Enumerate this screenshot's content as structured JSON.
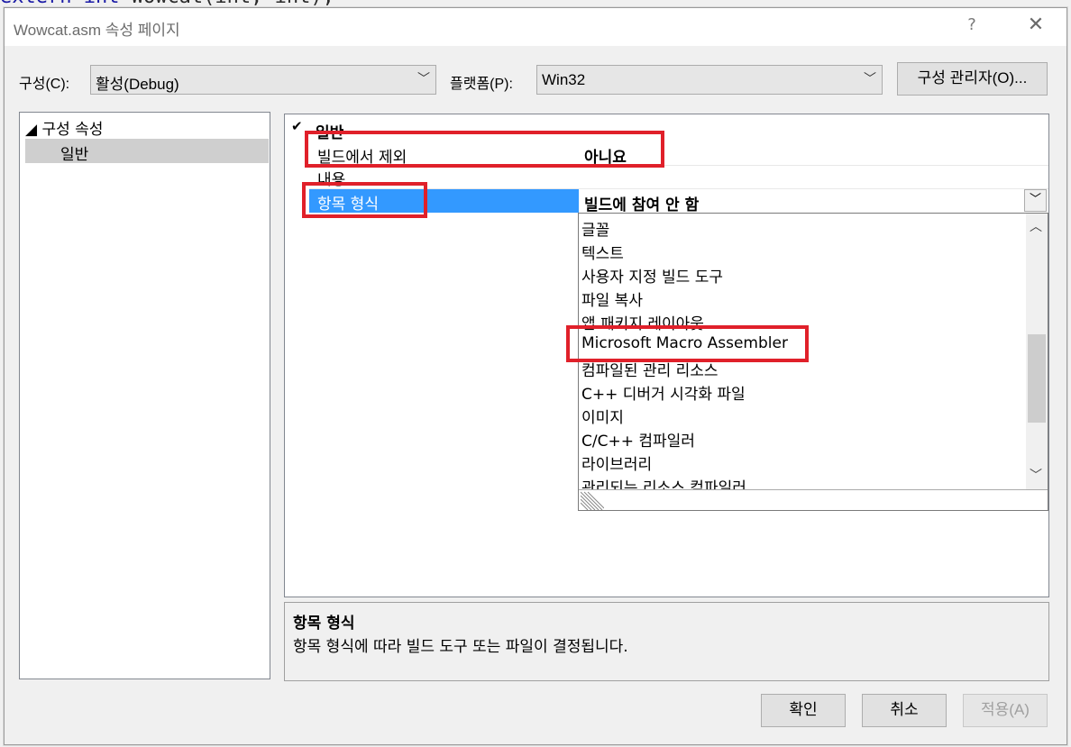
{
  "background_code": {
    "kw": "extern int",
    "fn": "Wowcat(int, int);"
  },
  "window": {
    "title": "Wowcat.asm 속성 페이지",
    "help": "?",
    "close": "✕"
  },
  "toolbar": {
    "config_label": "구성(C):",
    "config_value": "활성(Debug)",
    "platform_label": "플랫폼(P):",
    "platform_value": "Win32",
    "config_manager": "구성 관리자(O)..."
  },
  "tree": {
    "root": "◢ 구성 속성",
    "child": "일반"
  },
  "grid": {
    "category": "일반",
    "rows": [
      {
        "name": "빌드에서 제외",
        "value": "아니요"
      },
      {
        "name": "내용",
        "value": ""
      },
      {
        "name": "항목 형식",
        "value": "빌드에 참여 안 함"
      }
    ]
  },
  "dropdown": {
    "items": [
      "글꼴",
      "텍스트",
      "사용자 지정 빌드 도구",
      "파일 복사",
      "앱 패키지 레이아웃",
      "Microsoft Macro Assembler",
      "컴파일된 관리 리소스",
      "C++ 디버거 시각화 파일",
      "이미지",
      "C/C++ 컴파일러",
      "라이브러리",
      "관리되는 리소스 컴파일러"
    ]
  },
  "description": {
    "title": "항목 형식",
    "text": "항목 형식에 따라 빌드 도구 또는 파일이 결정됩니다."
  },
  "buttons": {
    "ok": "확인",
    "cancel": "취소",
    "apply": "적용(A)"
  },
  "colors": {
    "selection": "#3399ff",
    "highlight_box": "#e0202a",
    "disabled_text": "#a0a0a0"
  }
}
